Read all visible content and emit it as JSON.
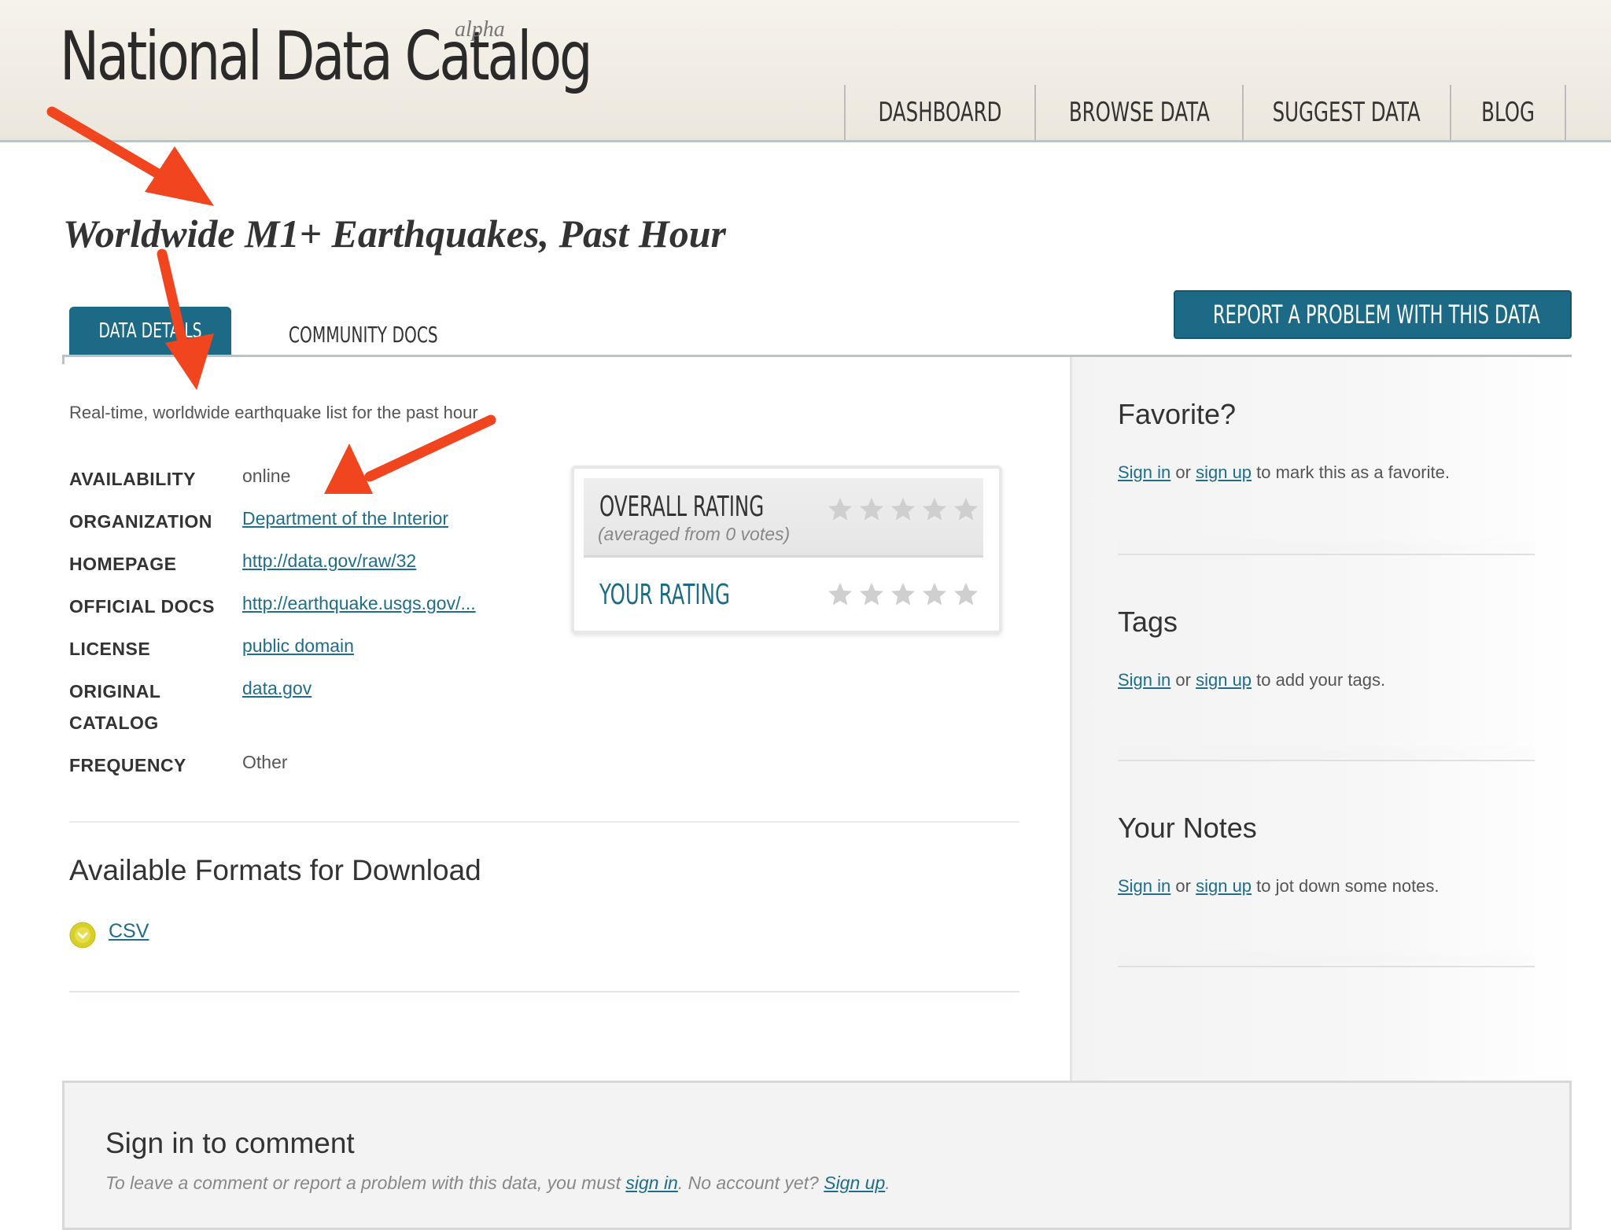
{
  "header": {
    "logo": "National Data Catalog",
    "logo_sup": "alpha",
    "nav": [
      "DASHBOARD",
      "BROWSE DATA",
      "SUGGEST DATA",
      "BLOG"
    ]
  },
  "page": {
    "title": "Worldwide M1+ Earthquakes, Past Hour",
    "tabs": [
      "DATA DETAILS",
      "COMMUNITY DOCS"
    ],
    "report_button": "REPORT A PROBLEM WITH THIS DATA",
    "description": "Real-time, worldwide earthquake list for the past hour"
  },
  "details": {
    "availability": {
      "label": "AVAILABILITY",
      "value": "online"
    },
    "organization": {
      "label": "ORGANIZATION",
      "value": "Department of the Interior"
    },
    "homepage": {
      "label": "HOMEPAGE",
      "value": "http://data.gov/raw/32"
    },
    "official_docs": {
      "label": "OFFICIAL DOCS",
      "value": "http://earthquake.usgs.gov/..."
    },
    "license": {
      "label": "LICENSE",
      "value": "public domain"
    },
    "original_catalog": {
      "label_line1": "ORIGINAL",
      "label_line2": "CATALOG",
      "value": "data.gov"
    },
    "frequency": {
      "label": "FREQUENCY",
      "value": "Other"
    }
  },
  "rating": {
    "overall_label": "OVERALL RATING",
    "votes_text": "(averaged from 0 votes)",
    "your_label": "YOUR RATING",
    "overall_value": 0,
    "your_value": 0,
    "max_stars": 5
  },
  "formats": {
    "heading": "Available Formats for Download",
    "items": [
      "CSV"
    ]
  },
  "sidebar": {
    "favorite": {
      "heading": "Favorite?",
      "sign_in": "Sign in",
      "or": "or",
      "sign_up": "sign up",
      "rest": "to mark this as a favorite."
    },
    "tags": {
      "heading": "Tags",
      "sign_in": "Sign in",
      "or": "or",
      "sign_up": "sign up",
      "rest": "to add your tags."
    },
    "notes": {
      "heading": "Your Notes",
      "sign_in": "Sign in",
      "or": "or",
      "sign_up": "sign up",
      "rest": "to jot down some notes."
    }
  },
  "comment": {
    "heading": "Sign in to comment",
    "text_before": "To leave a comment or report a problem with this data, you must ",
    "sign_in": "sign in",
    "text_mid": ". No account yet? ",
    "sign_up": "Sign up",
    "text_after": "."
  },
  "colors": {
    "accent": "#1c6a86",
    "link": "#1e6d8a",
    "annotation_arrow": "#f0451f",
    "download_icon": "#d9cf2a"
  }
}
